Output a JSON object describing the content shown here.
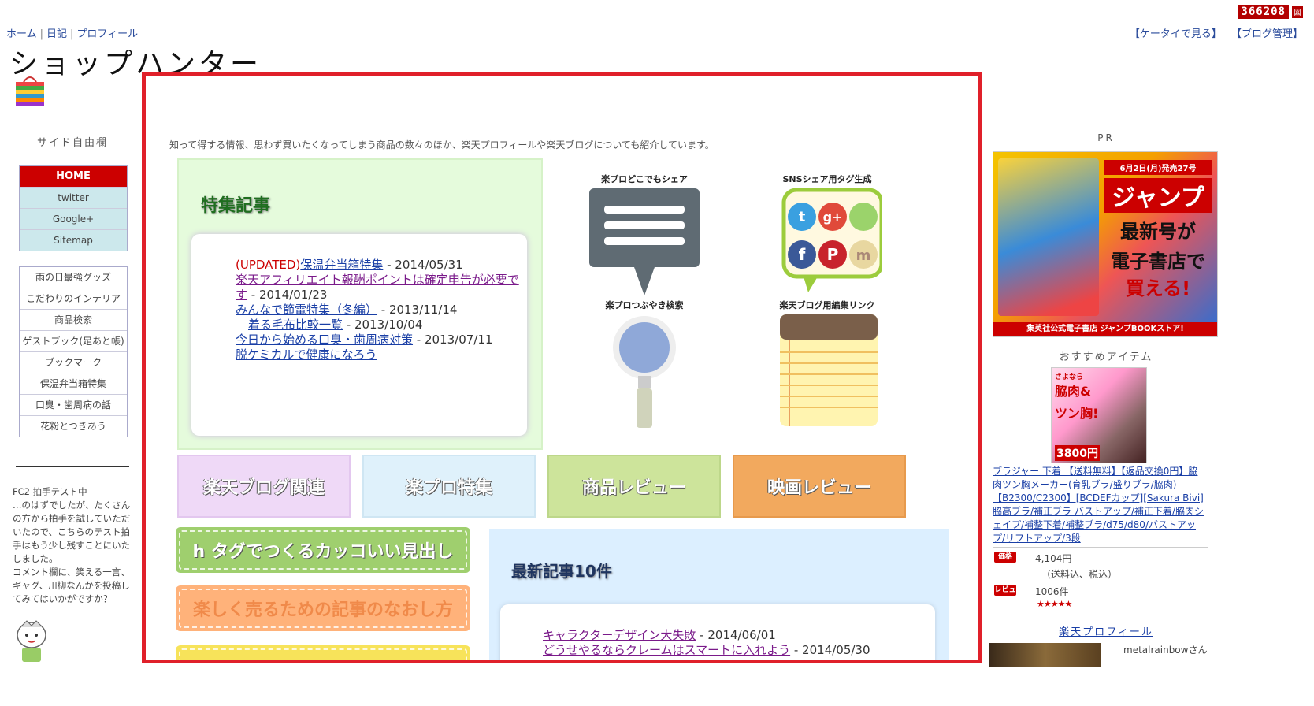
{
  "topnav": {
    "home": "ホーム",
    "diary": "日記",
    "profile": "プロフィール",
    "sep": "|"
  },
  "counter": {
    "value": "366208",
    "icon": "図"
  },
  "toplinks": {
    "mobile": "【ケータイで見る】",
    "admin": "【ブログ管理】"
  },
  "site_title": "ショップハンター",
  "sidebar": {
    "free_label": "サイド自由欄",
    "menu1": [
      "HOME",
      "twitter",
      "Google+",
      "Sitemap"
    ],
    "menu2": [
      "雨の日最強グッズ",
      "こだわりのインテリア",
      "商品検索",
      "ゲストブック(足あと帳)",
      "ブックマーク",
      "保温弁当箱特集",
      "口臭・歯周病の話",
      "花粉とつきあう"
    ],
    "clap_text": "FC2 拍手テスト中\n…のはずでしたが、たくさんの方から拍手を試していただいたので、こちらのテスト拍手はもう少し残すことにいたしました。\nコメント欄に、笑える一言、ギャグ、川柳なんかを投稿してみてはいかがですか？"
  },
  "main": {
    "intro": "知って得する情報、思わず買いたくなってしまう商品の数々のほか、楽天プロフィールや楽天ブログについても紹介しています。",
    "featured": {
      "title": "特集記事",
      "items": [
        {
          "prefix": "(UPDATED)",
          "link": "保温弁当箱特集",
          "date": " - 2014/05/31"
        },
        {
          "prefix": "",
          "link": "楽天アフィリエイト報酬ポイントは確定申告が必要です",
          "date": " - 2014/01/23"
        },
        {
          "prefix": "",
          "link": "みんなで節電特集（冬編）",
          "date": " - 2013/11/14"
        },
        {
          "prefix": "",
          "link": "着る毛布比較一覧",
          "date": " - 2013/10/04"
        },
        {
          "prefix": "",
          "link": "今日から始める口臭・歯周病対策",
          "date": " - 2013/07/11"
        },
        {
          "prefix": "",
          "link": "脱ケミカルで健康になろう",
          "date": ""
        }
      ]
    },
    "tools": [
      {
        "label": "楽プロどこでもシェア"
      },
      {
        "label": "SNSシェア用タグ生成"
      },
      {
        "label": "楽プロつぶやき検索"
      },
      {
        "label": "楽天ブログ用編集リンク"
      }
    ],
    "categories": [
      "楽天ブログ関連",
      "楽プロ特集",
      "商品レビュー",
      "映画レビュー"
    ],
    "ribbons": [
      "h タグでつくるカッコいい見出し",
      "楽しく売るための記事のなおし方",
      ""
    ],
    "latest": {
      "title": "最新記事10件",
      "items": [
        {
          "link": "キャラクターデザイン大失敗",
          "date": " - 2014/06/01"
        },
        {
          "link": "どうせやるならクレームはスマートに入れよう",
          "date": " - 2014/05/30"
        }
      ]
    }
  },
  "right": {
    "pr_label": "PR",
    "ad": {
      "date": "6月2日(月)発売27号",
      "brand": "ジャンプ",
      "line1": "最新号が",
      "line2": "電子書店で",
      "line3": "買える!",
      "bar": "集英社公式電子書店 ジャンプBOOKストア!"
    },
    "recommend_label": "おすすめアイテム",
    "product_img": {
      "t1": "さよなら",
      "t2": "脇肉&",
      "t3": "ツン胸!",
      "t4": "3800円"
    },
    "product_name": "ブラジャー 下着 【送料無料】【返品交換0円】脇肉ツン胸メーカー(育乳ブラ/盛りブラ/脇肉)【B2300/C2300】[BCDEFカップ][Sakura Bivi]脇高ブラ/補正ブラ バストアップ/補正下着/脇肉シェイプ/補整下着/補整ブラ/d75/d80/バストアップ/リフトアップ/3段",
    "price_tag": "価格",
    "price": "4,104円",
    "price_note": "（送料込、税込）",
    "review_tag": "レビュー",
    "review_count": "1006件",
    "stars": "★★★★★",
    "profile_head": "楽天プロフィール",
    "profile_name": "metalrainbowさん"
  },
  "colors": {
    "accent": "#e0202a",
    "home": "#cc0000",
    "link": "#1a3fa6"
  }
}
